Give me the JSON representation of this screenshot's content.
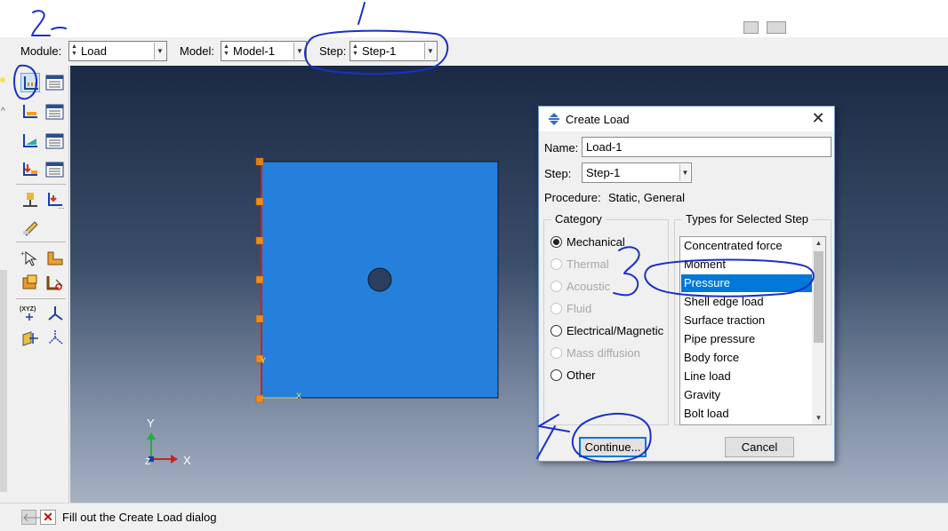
{
  "context_bar": {
    "module_label": "Module:",
    "module_value": "Load",
    "model_label": "Model:",
    "model_value": "Model-1",
    "step_label": "Step:",
    "step_value": "Step-1"
  },
  "viewport": {
    "triad": {
      "x_label": "X",
      "y_label": "Y",
      "z_label": "Z"
    },
    "part_axis": {
      "x_label": "X",
      "y_label": "Y"
    }
  },
  "status_bar": {
    "back_icon": "left-arrow-icon",
    "cancel_icon": "red-x-icon",
    "message": "Fill out the Create Load dialog"
  },
  "create_load_dialog": {
    "title": "Create Load",
    "close_glyph": "✕",
    "name_label": "Name:",
    "name_value": "Load-1",
    "step_label": "Step:",
    "step_value": "Step-1",
    "procedure_label": "Procedure:",
    "procedure_value": "Static, General",
    "category_title": "Category",
    "categories": [
      {
        "label": "Mechanical",
        "checked": true,
        "enabled": true
      },
      {
        "label": "Thermal",
        "checked": false,
        "enabled": false
      },
      {
        "label": "Acoustic",
        "checked": false,
        "enabled": false
      },
      {
        "label": "Fluid",
        "checked": false,
        "enabled": false
      },
      {
        "label": "Electrical/Magnetic",
        "checked": false,
        "enabled": true
      },
      {
        "label": "Mass diffusion",
        "checked": false,
        "enabled": false
      },
      {
        "label": "Other",
        "checked": false,
        "enabled": true
      }
    ],
    "types_title": "Types for Selected Step",
    "types": [
      "Concentrated force",
      "Moment",
      "Pressure",
      "Shell edge load",
      "Surface traction",
      "Pipe pressure",
      "Body force",
      "Line load",
      "Gravity",
      "Bolt load"
    ],
    "selected_type": "Pressure",
    "continue_label": "Continue...",
    "cancel_label": "Cancel"
  },
  "annotations": {
    "mark_1": "1",
    "mark_2": "2",
    "mark_4": "4"
  },
  "colors": {
    "part_fill": "#2580db",
    "selection_blue": "#0078d7",
    "annotation_ink": "#1a2fc8",
    "boundary_red": "#d81e1e",
    "bc_orange": "#f08c1e"
  }
}
